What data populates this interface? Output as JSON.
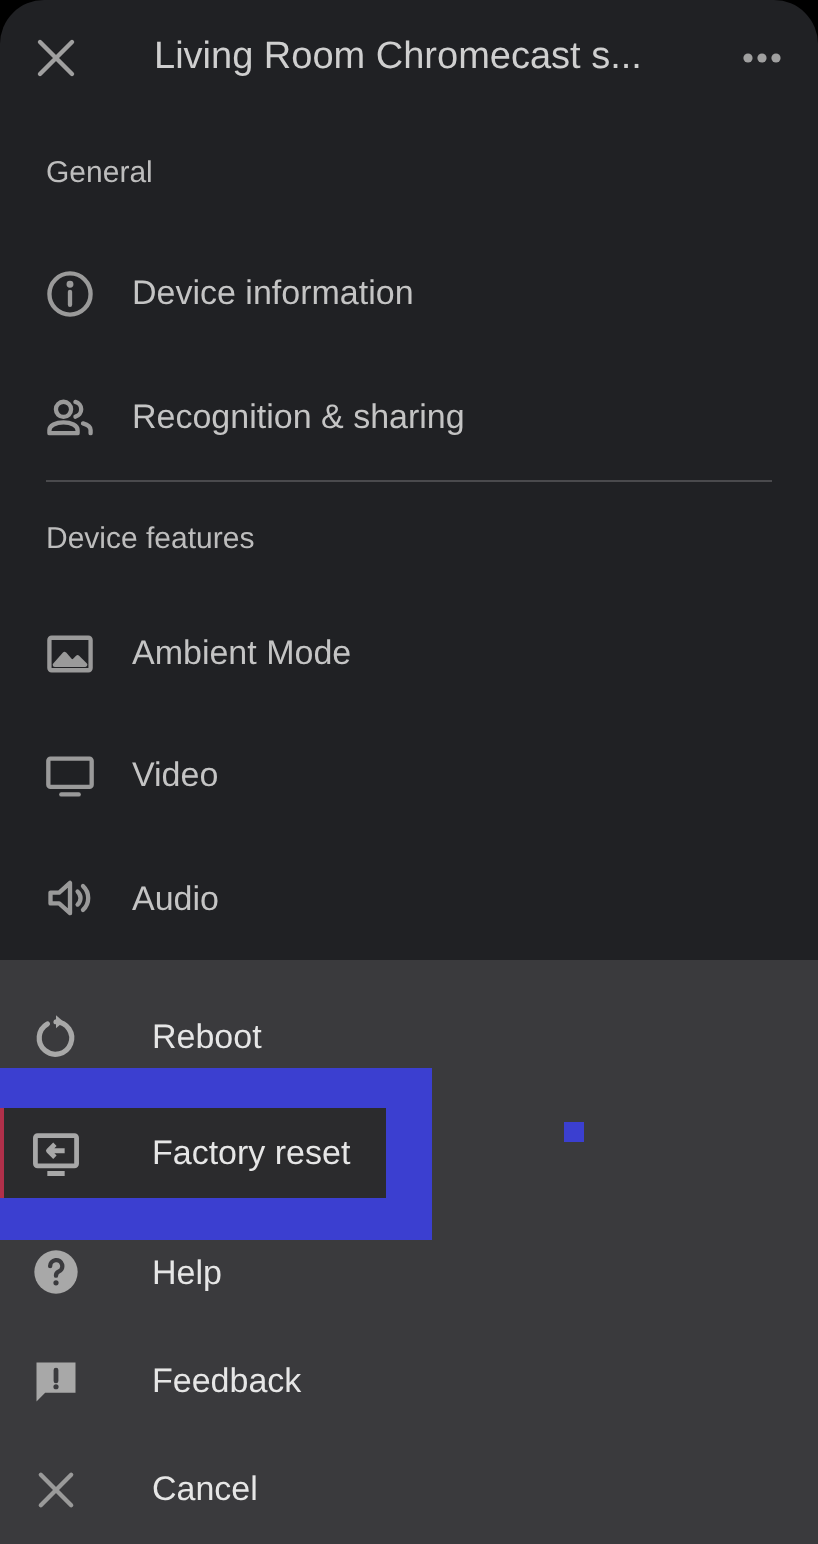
{
  "header": {
    "title": "Living Room Chromecast s..."
  },
  "sections": [
    {
      "heading": "General",
      "items": [
        {
          "label": "Device information"
        },
        {
          "label": "Recognition & sharing"
        }
      ]
    },
    {
      "heading": "Device features",
      "items": [
        {
          "label": "Ambient Mode"
        },
        {
          "label": "Video"
        },
        {
          "label": "Audio"
        }
      ]
    }
  ],
  "sheet": {
    "items": [
      {
        "label": "Reboot",
        "selected": false
      },
      {
        "label": "Factory reset",
        "selected": true
      },
      {
        "label": "Help",
        "selected": false
      },
      {
        "label": "Feedback",
        "selected": false
      },
      {
        "label": "Cancel",
        "selected": false
      }
    ]
  }
}
